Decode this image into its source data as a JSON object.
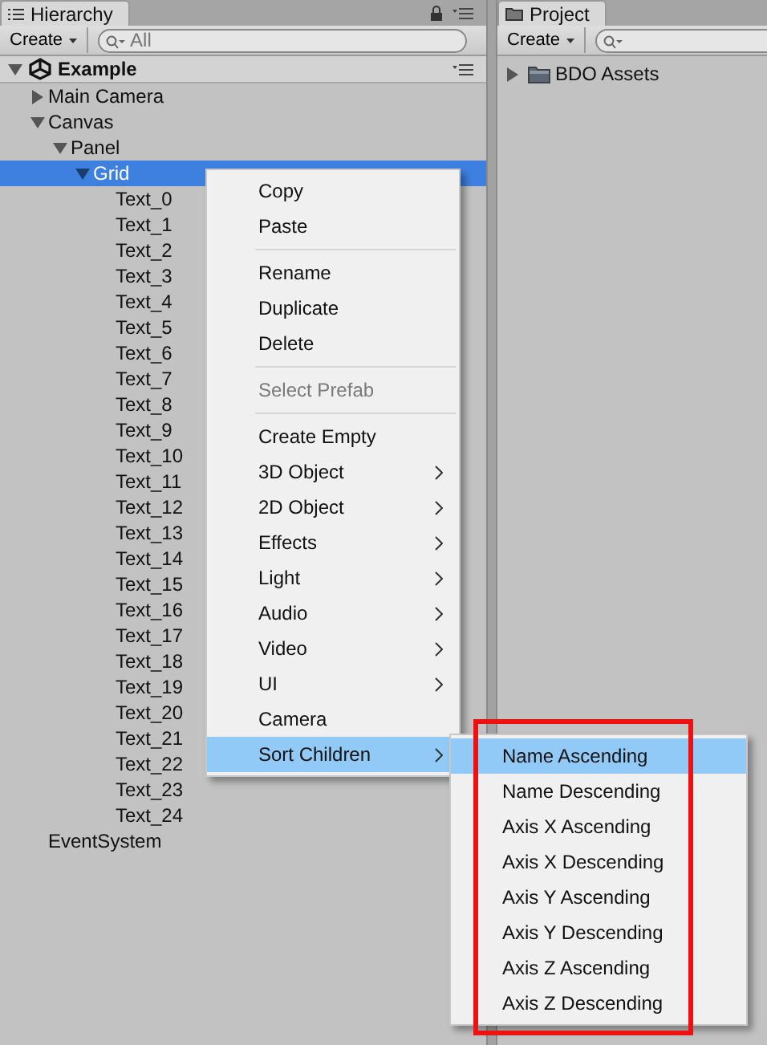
{
  "hierarchy": {
    "tab": "Hierarchy",
    "create_button": "Create",
    "search": {
      "placeholder": "All"
    },
    "scene": {
      "name": "Example",
      "expanded": true,
      "children": [
        {
          "name": "Main Camera",
          "selected": false,
          "expanded": false
        },
        {
          "name": "Canvas",
          "selected": false,
          "expanded": true,
          "children": [
            {
              "name": "Panel",
              "selected": false,
              "expanded": true,
              "children": [
                {
                  "name": "Grid",
                  "selected": true,
                  "expanded": true,
                  "children": [
                    {
                      "name": "Text_0",
                      "selected": false
                    },
                    {
                      "name": "Text_1",
                      "selected": false
                    },
                    {
                      "name": "Text_2",
                      "selected": false
                    },
                    {
                      "name": "Text_3",
                      "selected": false
                    },
                    {
                      "name": "Text_4",
                      "selected": false
                    },
                    {
                      "name": "Text_5",
                      "selected": false
                    },
                    {
                      "name": "Text_6",
                      "selected": false
                    },
                    {
                      "name": "Text_7",
                      "selected": false
                    },
                    {
                      "name": "Text_8",
                      "selected": false
                    },
                    {
                      "name": "Text_9",
                      "selected": false
                    },
                    {
                      "name": "Text_10",
                      "selected": false
                    },
                    {
                      "name": "Text_11",
                      "selected": false
                    },
                    {
                      "name": "Text_12",
                      "selected": false
                    },
                    {
                      "name": "Text_13",
                      "selected": false
                    },
                    {
                      "name": "Text_14",
                      "selected": false
                    },
                    {
                      "name": "Text_15",
                      "selected": false
                    },
                    {
                      "name": "Text_16",
                      "selected": false
                    },
                    {
                      "name": "Text_17",
                      "selected": false
                    },
                    {
                      "name": "Text_18",
                      "selected": false
                    },
                    {
                      "name": "Text_19",
                      "selected": false
                    },
                    {
                      "name": "Text_20",
                      "selected": false
                    },
                    {
                      "name": "Text_21",
                      "selected": false
                    },
                    {
                      "name": "Text_22",
                      "selected": false
                    },
                    {
                      "name": "Text_23",
                      "selected": false
                    },
                    {
                      "name": "Text_24",
                      "selected": false
                    }
                  ]
                }
              ]
            }
          ]
        },
        {
          "name": "EventSystem",
          "selected": false
        }
      ]
    }
  },
  "project": {
    "tab": "Project",
    "create_button": "Create",
    "items": [
      {
        "name": "BDO Assets",
        "expanded": false
      }
    ]
  },
  "context_menu": {
    "groups": [
      [
        {
          "label": "Copy",
          "disabled": false,
          "submenu": false,
          "selected": false
        },
        {
          "label": "Paste",
          "disabled": false,
          "submenu": false,
          "selected": false
        }
      ],
      [
        {
          "label": "Rename",
          "disabled": false,
          "submenu": false,
          "selected": false
        },
        {
          "label": "Duplicate",
          "disabled": false,
          "submenu": false,
          "selected": false
        },
        {
          "label": "Delete",
          "disabled": false,
          "submenu": false,
          "selected": false
        }
      ],
      [
        {
          "label": "Select Prefab",
          "disabled": true,
          "submenu": false,
          "selected": false
        }
      ],
      [
        {
          "label": "Create Empty",
          "disabled": false,
          "submenu": false,
          "selected": false
        },
        {
          "label": "3D Object",
          "disabled": false,
          "submenu": true,
          "selected": false
        },
        {
          "label": "2D Object",
          "disabled": false,
          "submenu": true,
          "selected": false
        },
        {
          "label": "Effects",
          "disabled": false,
          "submenu": true,
          "selected": false
        },
        {
          "label": "Light",
          "disabled": false,
          "submenu": true,
          "selected": false
        },
        {
          "label": "Audio",
          "disabled": false,
          "submenu": true,
          "selected": false
        },
        {
          "label": "Video",
          "disabled": false,
          "submenu": true,
          "selected": false
        },
        {
          "label": "UI",
          "disabled": false,
          "submenu": true,
          "selected": false
        },
        {
          "label": "Camera",
          "disabled": false,
          "submenu": false,
          "selected": false
        },
        {
          "label": "Sort Children",
          "disabled": false,
          "submenu": true,
          "selected": true
        }
      ]
    ]
  },
  "sort_submenu": {
    "highlighted_box": true,
    "items": [
      {
        "label": "Name Ascending",
        "selected": true
      },
      {
        "label": "Name Descending",
        "selected": false
      },
      {
        "label": "Axis X Ascending",
        "selected": false
      },
      {
        "label": "Axis X Descending",
        "selected": false
      },
      {
        "label": "Axis Y Ascending",
        "selected": false
      },
      {
        "label": "Axis Y Descending",
        "selected": false
      },
      {
        "label": "Axis Z Ascending",
        "selected": false
      },
      {
        "label": "Axis Z Descending",
        "selected": false
      }
    ]
  }
}
